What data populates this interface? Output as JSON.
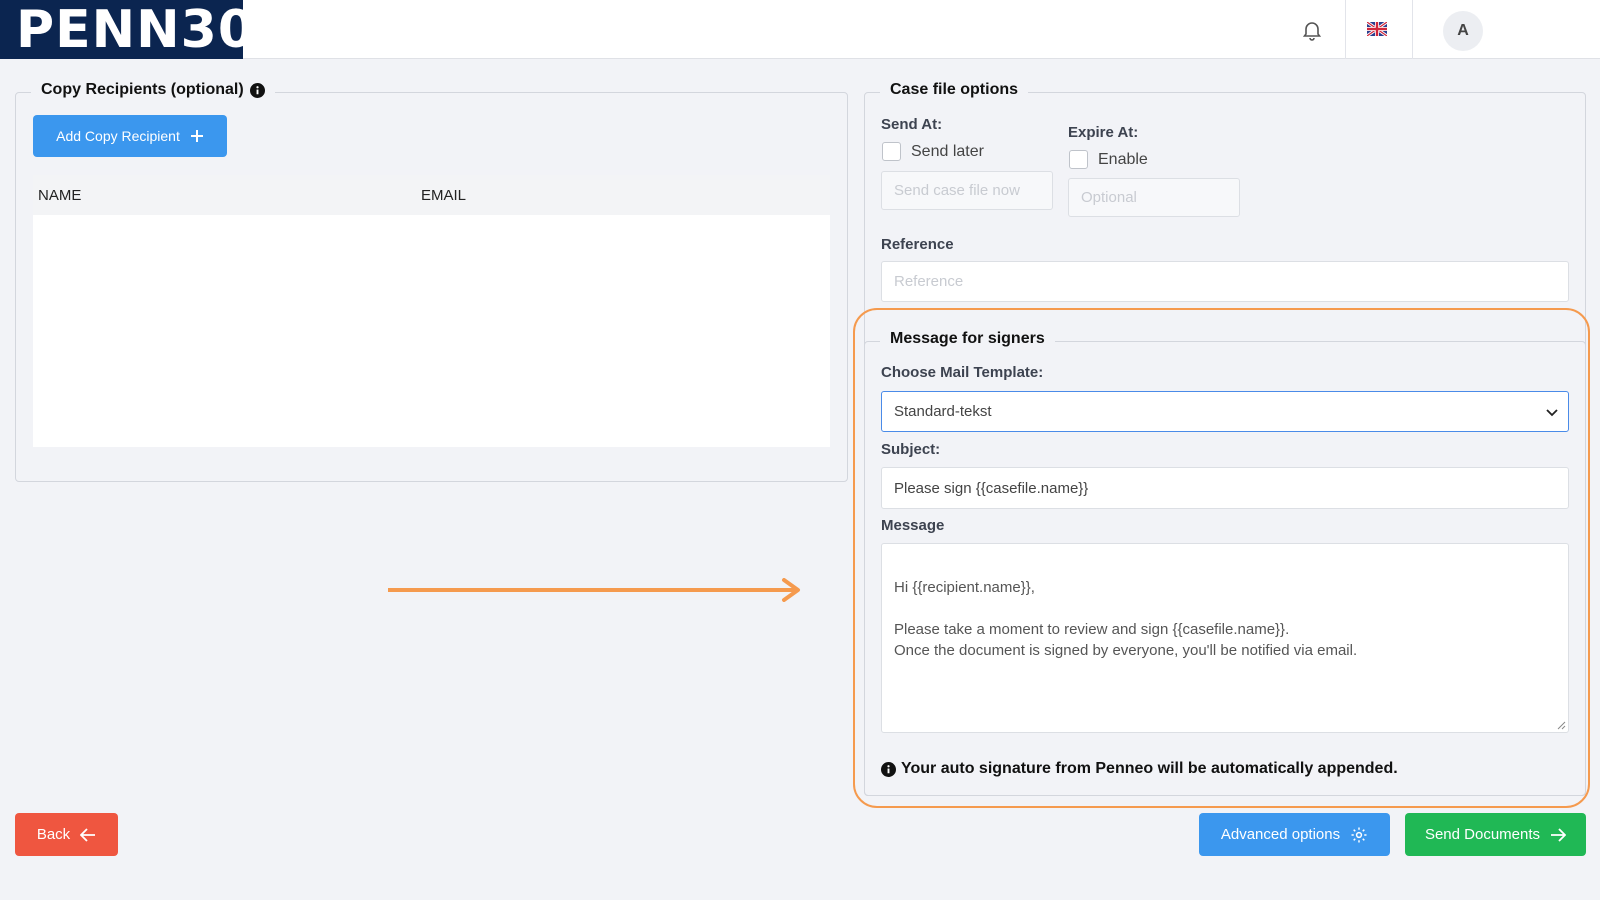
{
  "header": {
    "logo_text": "PENN30",
    "logo_mark": "®",
    "avatar_initial": "A",
    "icons": {
      "bell": "bell-icon",
      "flag": "uk-flag-icon"
    }
  },
  "copy_recipients": {
    "title": "Copy Recipients (optional)",
    "add_button": "Add Copy Recipient",
    "columns": [
      "NAME",
      "EMAIL"
    ]
  },
  "case_options": {
    "title": "Case file options",
    "send_at_label": "Send At:",
    "send_later_label": "Send later",
    "send_placeholder": "Send case file now",
    "expire_at_label": "Expire At:",
    "expire_enable_label": "Enable",
    "expire_placeholder": "Optional",
    "reference_label": "Reference",
    "reference_placeholder": "Reference"
  },
  "message": {
    "title": "Message for signers",
    "template_label": "Choose Mail Template:",
    "template_value": "Standard-tekst",
    "subject_label": "Subject:",
    "subject_value": "Please sign {{casefile.name}}",
    "message_label": "Message",
    "message_value": "Hi {{recipient.name}},\n\nPlease take a moment to review and sign {{casefile.name}}.\nOnce the document is signed by everyone, you'll be notified via email.",
    "notice": "Your auto signature from Penneo will be automatically appended."
  },
  "footer": {
    "back": "Back",
    "advanced": "Advanced options",
    "send": "Send Documents"
  },
  "colors": {
    "navy": "#0b2550",
    "primary": "#3b97ee",
    "danger": "#ef5640",
    "success": "#20b855",
    "highlight": "#f59a4e"
  }
}
